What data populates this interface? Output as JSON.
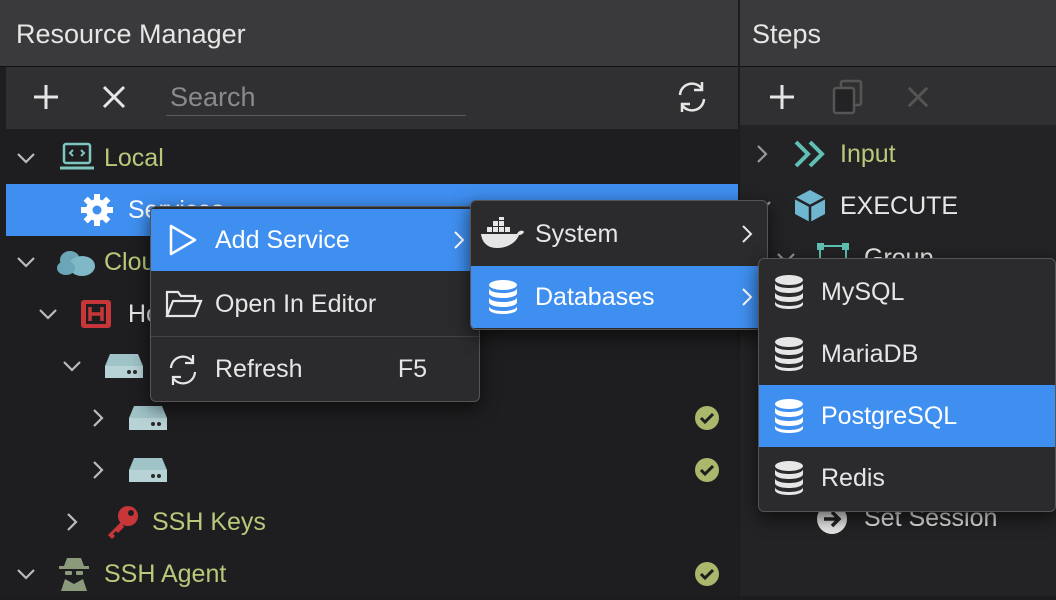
{
  "resource_manager": {
    "title": "Resource Manager",
    "search_placeholder": "Search",
    "tree": {
      "local": "Local",
      "services": "Services",
      "cloud": "Cloud",
      "hosts": "Hosts",
      "ssh_keys": "SSH Keys",
      "ssh_agent": "SSH Agent"
    }
  },
  "steps": {
    "title": "Steps",
    "items": {
      "input": "Input",
      "execute": "EXECUTE",
      "group": "Group",
      "set_session": "Set Session"
    }
  },
  "context_menu": {
    "add_service": "Add Service",
    "open_in_editor": "Open In Editor",
    "refresh": "Refresh",
    "refresh_shortcut": "F5"
  },
  "service_submenu": {
    "system": "System",
    "databases": "Databases"
  },
  "databases_submenu": {
    "items": [
      "MySQL",
      "MariaDB",
      "PostgreSQL",
      "Redis"
    ],
    "highlighted": "PostgreSQL"
  },
  "colors": {
    "accent": "#3f8ff0",
    "green_label": "#b8c97a",
    "check": "#a9b86a"
  }
}
